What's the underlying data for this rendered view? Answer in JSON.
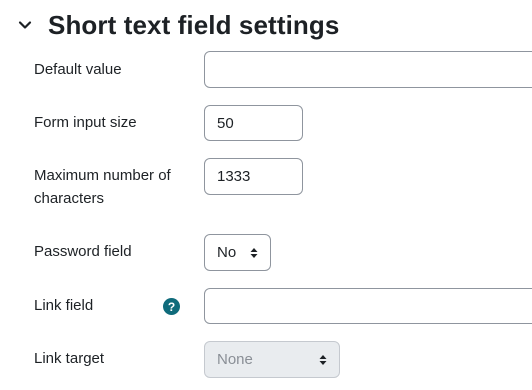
{
  "section": {
    "title": "Short text field settings",
    "expanded_icon": "chevron-down-icon"
  },
  "fields": {
    "default_value": {
      "label": "Default value",
      "value": ""
    },
    "form_input_size": {
      "label": "Form input size",
      "value": "50"
    },
    "max_chars": {
      "label_line1": "Maximum number of",
      "label_line2": "characters",
      "value": "1333"
    },
    "password_field": {
      "label": "Password field",
      "selected": "No"
    },
    "link_field": {
      "label": "Link field",
      "help_icon": "question-circle-icon",
      "help_glyph": "?",
      "value": ""
    },
    "link_target": {
      "label": "Link target",
      "selected": "None",
      "disabled": true
    }
  },
  "colors": {
    "help_icon_bg": "#0f6b7b",
    "border": "#8f959e",
    "disabled_bg": "#e9ecef",
    "text": "#1d2125"
  }
}
